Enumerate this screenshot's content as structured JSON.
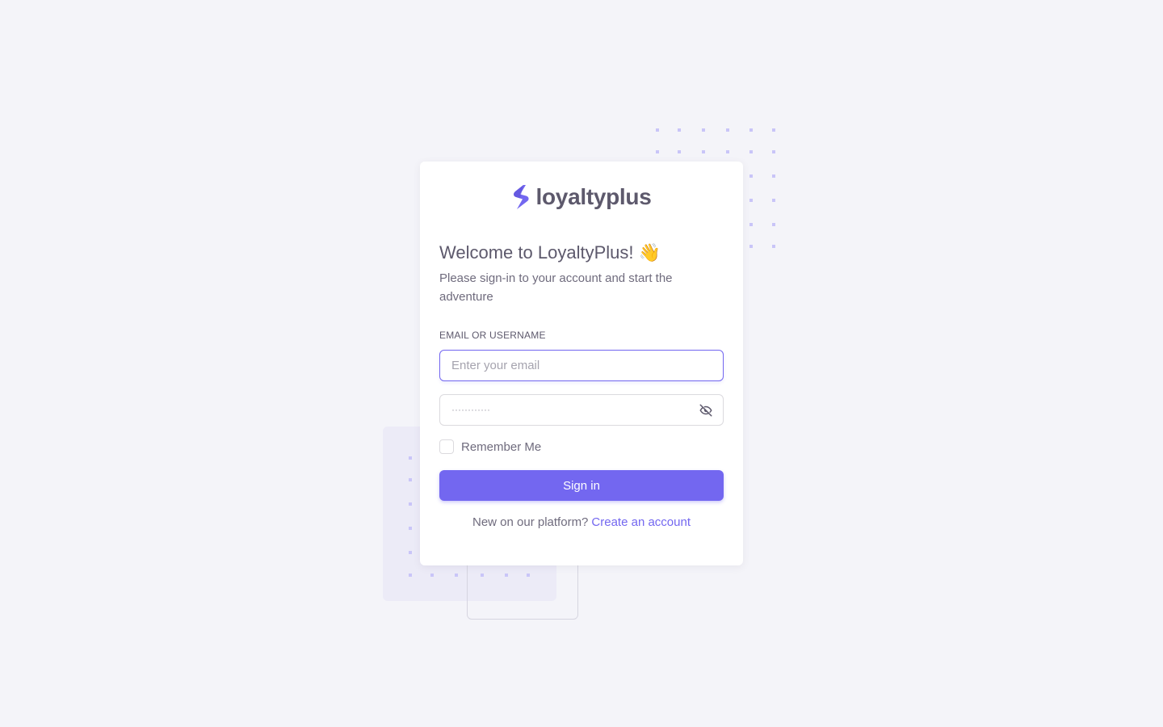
{
  "brand": {
    "name": "loyaltyplus",
    "accent_color": "#7367f0"
  },
  "login": {
    "welcome_title": "Welcome to LoyaltyPlus!",
    "welcome_emoji": "👋",
    "subtitle": "Please sign-in to your account and start the adventure",
    "email_label": "EMAIL OR USERNAME",
    "email_value": "",
    "email_placeholder": "Enter your email",
    "password_mask": "············",
    "password_toggle_icon": "eye-off-icon",
    "remember_label": "Remember Me",
    "remember_checked": false,
    "signin_label": "Sign in",
    "footer_text": "New on our platform?",
    "create_account_label": "Create an account"
  }
}
